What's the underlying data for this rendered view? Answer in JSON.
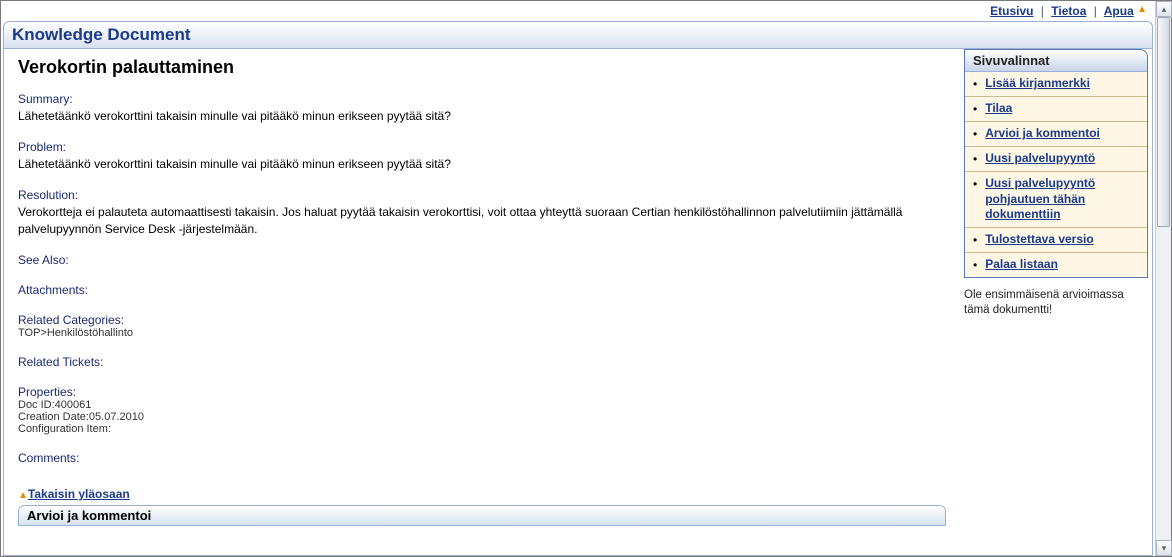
{
  "topnav": {
    "home": "Etusivu",
    "about": "Tietoa",
    "help": "Apua",
    "separator": "|"
  },
  "titlebar": {
    "title": "Knowledge Document"
  },
  "document": {
    "heading": "Verokortin palauttaminen",
    "summary_label": "Summary:",
    "summary_text": "Lähetetäänkö verokorttini takaisin minulle vai pitääkö minun erikseen pyytää sitä?",
    "problem_label": "Problem:",
    "problem_text": "Lähetetäänkö verokorttini takaisin minulle vai pitääkö minun erikseen pyytää sitä?",
    "resolution_label": "Resolution:",
    "resolution_text": "Verokortteja ei palauteta automaattisesti takaisin. Jos haluat pyytää takaisin verokorttisi, voit ottaa yhteyttä suoraan Certian henkilöstöhallinnon palvelutiimiin jättämällä palvelupyynnön Service Desk -järjestelmään.",
    "seealso_label": "See Also:",
    "attachments_label": "Attachments:",
    "related_categories_label": "Related Categories:",
    "related_categories_text": "TOP>Henkilöstöhallinto",
    "related_tickets_label": "Related Tickets:",
    "properties_label": "Properties:",
    "doc_id": "Doc ID:400061",
    "creation_date": "Creation Date:05.07.2010",
    "config_item": "Configuration Item:",
    "comments_label": "Comments:",
    "back_to_top": "Takaisin yläosaan",
    "review_header": "Arvioi ja kommentoi"
  },
  "sidebar": {
    "title": "Sivuvalinnat",
    "items": [
      {
        "label": "Lisää kirjanmerkki"
      },
      {
        "label": "Tilaa"
      },
      {
        "label": "Arvioi ja kommentoi"
      },
      {
        "label": "Uusi palvelupyyntö"
      },
      {
        "label": "Uusi palvelupyyntö pohjautuen tähän dokumenttiin"
      },
      {
        "label": "Tulostettava versio"
      },
      {
        "label": "Palaa listaan"
      }
    ],
    "footer": "Ole ensimmäisenä arvioimassa tämä dokumentti!"
  }
}
